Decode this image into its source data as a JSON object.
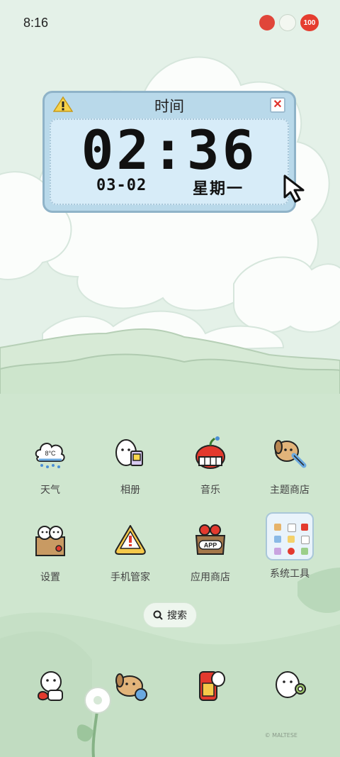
{
  "status_bar": {
    "time": "8:16",
    "battery": "100"
  },
  "widget": {
    "title": "时间",
    "clock": "02:36",
    "date": "03-02",
    "weekday": "星期一",
    "close_glyph": "✕"
  },
  "apps": [
    {
      "label": "天气",
      "icon": "weather-icon"
    },
    {
      "label": "相册",
      "icon": "gallery-icon"
    },
    {
      "label": "音乐",
      "icon": "music-icon"
    },
    {
      "label": "主题商店",
      "icon": "theme-store-icon"
    },
    {
      "label": "设置",
      "icon": "settings-icon"
    },
    {
      "label": "手机管家",
      "icon": "phone-manager-icon"
    },
    {
      "label": "应用商店",
      "icon": "app-store-icon"
    },
    {
      "label": "系统工具",
      "icon": "system-tools-folder-icon"
    }
  ],
  "weather_temp": "8°C",
  "app_store_badge": "APP",
  "search": {
    "label": "搜索"
  },
  "dock": [
    "phone-icon",
    "messages-icon",
    "contacts-icon",
    "camera-icon"
  ],
  "copyright": "© MALTESE",
  "colors": {
    "accent_red": "#e53d2f",
    "widget_blue": "#b9d9ea",
    "grass": "#cfe6cf"
  }
}
